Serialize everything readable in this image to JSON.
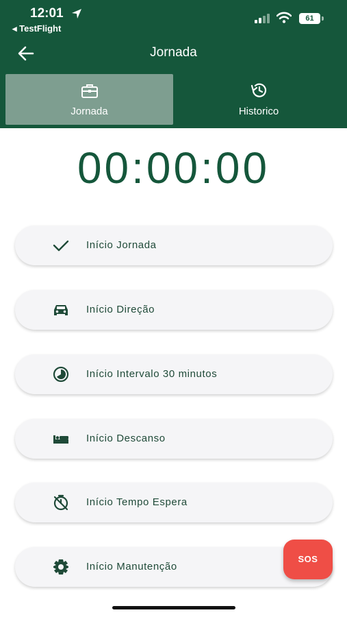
{
  "status_bar": {
    "time": "12:01",
    "back_app": "◂ TestFlight",
    "battery": "61"
  },
  "appbar": {
    "title": "Jornada"
  },
  "tabs": [
    {
      "label": "Jornada",
      "icon": "briefcase-icon",
      "active": true
    },
    {
      "label": "Historico",
      "icon": "history-icon",
      "active": false
    }
  ],
  "timer": "00:00:00",
  "actions": [
    {
      "label": "Início Jornada",
      "icon": "check-icon"
    },
    {
      "label": "Início Direção",
      "icon": "car-icon"
    },
    {
      "label": "Início Intervalo 30 minutos",
      "icon": "timelapse-icon"
    },
    {
      "label": "Início Descanso",
      "icon": "bed-icon"
    },
    {
      "label": "Início Tempo Espera",
      "icon": "timer-off-icon"
    },
    {
      "label": "Início Manutenção",
      "icon": "gear-icon"
    }
  ],
  "sos": {
    "label": "SOS"
  },
  "colors": {
    "primary": "#15573b",
    "tab_active": "#7e9e90",
    "button_bg": "#f5f5f7",
    "sos": "#ef4e46"
  }
}
